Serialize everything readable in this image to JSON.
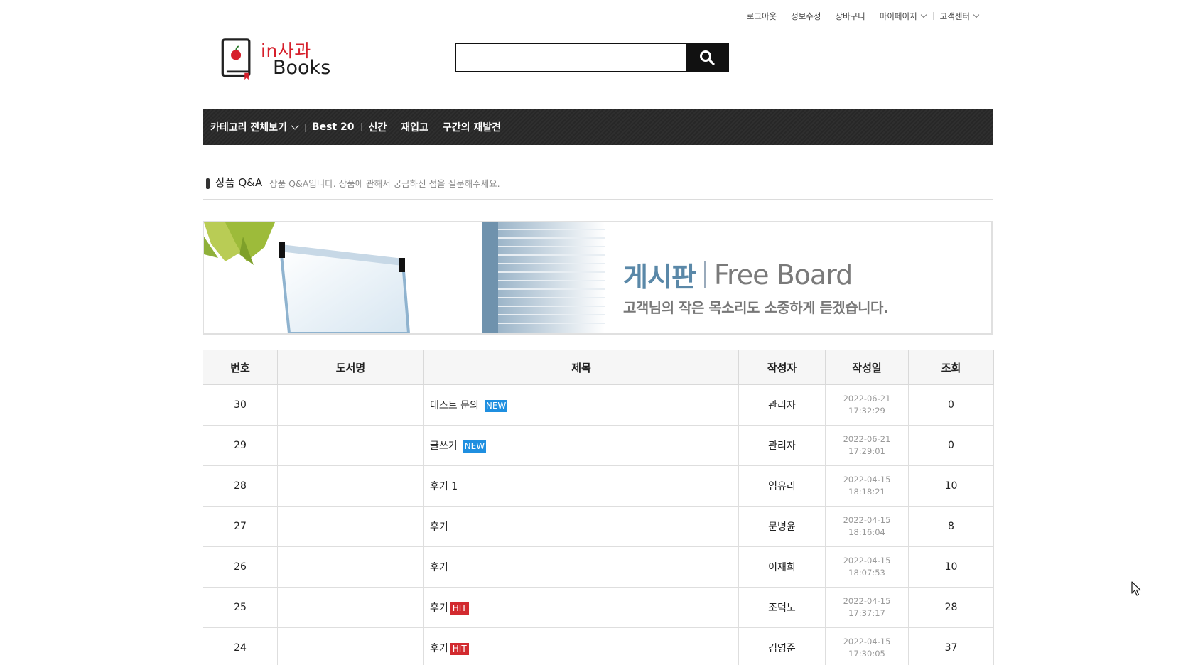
{
  "top_links": [
    "로그아웃",
    "정보수정",
    "장바구니",
    "마이페이지",
    "고객센터"
  ],
  "logo": {
    "line1": "in사과",
    "line2": "Books"
  },
  "search": {
    "value": "",
    "placeholder": ""
  },
  "nav": {
    "category_label": "카테고리 전체보기",
    "items": [
      "Best 20",
      "신간",
      "재입고",
      "구간의 재발견"
    ]
  },
  "section": {
    "title": "상품 Q&A",
    "description": "상품 Q&A입니다. 상품에 관해서 궁금하신 점을 질문해주세요."
  },
  "banner": {
    "title_ko": "게시판",
    "title_en": "Free Board",
    "subtitle": "고객님의 작은 목소리도 소중하게 듣겠습니다."
  },
  "table": {
    "headers": [
      "번호",
      "도서명",
      "제목",
      "작성자",
      "작성일",
      "조회"
    ],
    "rows": [
      {
        "no": "30",
        "book": "",
        "subject": "테스트 문의",
        "badge": "NEW",
        "author": "관리자",
        "date": "2022-06-21",
        "time": "17:32:29",
        "views": "0"
      },
      {
        "no": "29",
        "book": "",
        "subject": "글쓰기",
        "badge": "NEW",
        "author": "관리자",
        "date": "2022-06-21",
        "time": "17:29:01",
        "views": "0"
      },
      {
        "no": "28",
        "book": "",
        "subject": "후기 1",
        "badge": "",
        "author": "임유리",
        "date": "2022-04-15",
        "time": "18:18:21",
        "views": "10"
      },
      {
        "no": "27",
        "book": "",
        "subject": "후기",
        "badge": "",
        "author": "문병윤",
        "date": "2022-04-15",
        "time": "18:16:04",
        "views": "8"
      },
      {
        "no": "26",
        "book": "",
        "subject": "후기",
        "badge": "",
        "author": "이재희",
        "date": "2022-04-15",
        "time": "18:07:53",
        "views": "10"
      },
      {
        "no": "25",
        "book": "",
        "subject": "후기",
        "badge": "HIT",
        "author": "조덕노",
        "date": "2022-04-15",
        "time": "17:37:17",
        "views": "28"
      },
      {
        "no": "24",
        "book": "",
        "subject": "후기",
        "badge": "HIT",
        "author": "김영준",
        "date": "2022-04-15",
        "time": "17:30:05",
        "views": "37"
      }
    ]
  },
  "colors": {
    "brand_red": "#d61f2b",
    "nav_bg": "#2b2b2b",
    "badge_new": "#1f8fe0",
    "badge_hit": "#d22a2f"
  }
}
